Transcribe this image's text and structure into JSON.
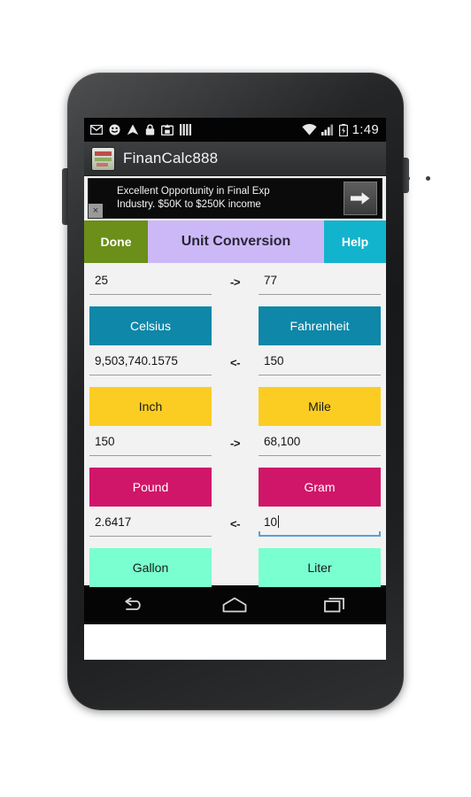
{
  "status_bar": {
    "icons": [
      "mail-icon",
      "smiley-icon",
      "navigation-icon",
      "lock-icon",
      "upload-icon",
      "bars-icon"
    ],
    "wifi_icon": "wifi-icon",
    "signal_icon": "cellular-signal-icon",
    "battery_icon": "battery-charging-icon",
    "clock": "1:49"
  },
  "app_bar": {
    "icon": "app-logo-icon",
    "title": "FinanCalc888"
  },
  "ad": {
    "line1": "Excellent Opportunity in Final Exp",
    "line2": "Industry. $50K to $250K income",
    "close_label": "×",
    "cta_icon": "arrow-right-icon"
  },
  "tabs": {
    "done_label": "Done",
    "title": "Unit Conversion",
    "help_label": "Help",
    "done_color": "#6b8f18",
    "title_color": "#cdb8f7",
    "help_color": "#12b4cd"
  },
  "conversions": [
    {
      "left_value": "25",
      "right_value": "77",
      "direction": "->",
      "left_unit": "Celsius",
      "right_unit": "Fahrenheit",
      "color": "#0e87a8",
      "text_tone": "light",
      "focused": "none"
    },
    {
      "left_value": "9,503,740.1575",
      "right_value": "150",
      "direction": "<-",
      "left_unit": "Inch",
      "right_unit": "Mile",
      "color": "#fbcd22",
      "text_tone": "dark",
      "focused": "none"
    },
    {
      "left_value": "150",
      "right_value": "68,100",
      "direction": "->",
      "left_unit": "Pound",
      "right_unit": "Gram",
      "color": "#d01669",
      "text_tone": "light",
      "focused": "none"
    },
    {
      "left_value": "2.6417",
      "right_value": "10",
      "direction": "<-",
      "left_unit": "Gallon",
      "right_unit": "Liter",
      "color": "#7affd0",
      "text_tone": "dark",
      "focused": "right"
    }
  ],
  "nav_bar": {
    "back_icon": "back-arrow-icon",
    "home_icon": "home-icon",
    "recents_icon": "recent-apps-icon"
  }
}
